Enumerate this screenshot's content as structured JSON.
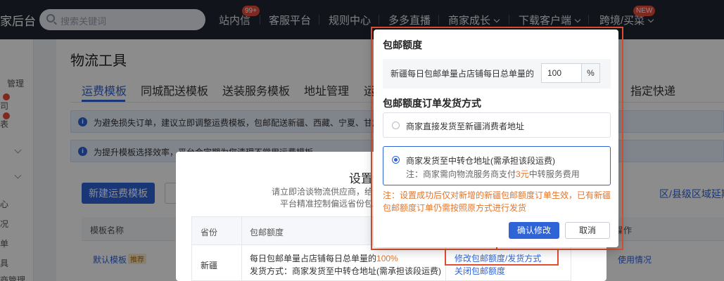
{
  "topnav": {
    "brand": "家后台",
    "search_placeholder": "搜索关键词",
    "items": [
      {
        "label": "站内信",
        "badge": "99+"
      },
      {
        "label": "客服平台"
      },
      {
        "label": "规则中心"
      },
      {
        "label": "多多直播"
      },
      {
        "label": "商家成长"
      },
      {
        "label": "下载客户端"
      },
      {
        "label": "跨境/买菜",
        "badge": "NEW"
      }
    ]
  },
  "sidebar": {
    "items": [
      "管理",
      "司",
      "表",
      "心",
      "况",
      "单",
      "具",
      "商管理"
    ]
  },
  "main": {
    "title": "物流工具",
    "tabs": [
      "运费模板",
      "同城配送模板",
      "送装服务模板",
      "地址管理",
      "运",
      "指定快递"
    ],
    "notices": [
      "为避免损失订单，建议立即调整运费模板，包邮配送新疆、西藏、宁夏、甘肃、青海",
      "为提升模板选择效率，平台会定期为您清理不常用运费模板"
    ],
    "new_template_button": "新建运费模板",
    "right_link": "区/县级区域延期",
    "table": {
      "headers": [
        "模板名称",
        "操作"
      ],
      "row": {
        "name": "默认模板",
        "tag": "推荐",
        "action": "使用情况"
      }
    }
  },
  "dialog": {
    "title": "设置包",
    "subtitle_1": "请立即洽谈物流供应商，给",
    "subtitle_2": "平台精准控制偏远省份包邮",
    "table": {
      "headers": [
        "省份",
        "包邮额度"
      ],
      "row": {
        "province": "新疆",
        "quota_text": "每日包邮单量占店铺每日总单量的",
        "quota_value": "100%",
        "method_text": "发货方式：商家发货至中转仓地址(需承担该段运费)",
        "link_modify": "修改包邮额度/发货方式",
        "link_close": "关闭包邮额度"
      }
    }
  },
  "popup": {
    "section1": "包邮额度",
    "quota_label": "新疆每日包邮单量占店铺每日总单量的",
    "quota_value": "100",
    "quota_unit": "%",
    "section2": "包邮额度订单发货方式",
    "option1": "商家直接发货至新疆消费者地址",
    "option2_title": "商家发货至中转仓地址(需承担该段运费)",
    "option2_note_prefix": "注：商家需向物流服务商支付",
    "option2_note_price": "3元",
    "option2_note_suffix": "中转服务费用",
    "note": "注：设置成功后仅对新增的新疆包邮额度订单生效，已有新疆包邮额度订单仍需按照原方式进行发货",
    "confirm": "确认修改",
    "cancel": "取消"
  },
  "colors": {
    "accent": "#2f63d8",
    "warning": "#e0762f",
    "highlight": "#e0502f"
  }
}
